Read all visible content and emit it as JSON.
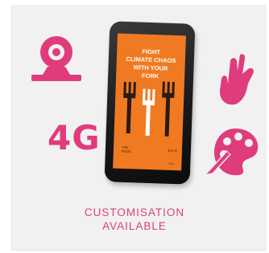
{
  "badge": {
    "network_label": "4G",
    "caption_line1": "CUSTOMISATION",
    "caption_line2": "AVAILABLE"
  },
  "tablet_screen": {
    "headline": "FIGHT\nCLIMATE CHAOS\nWITH YOUR\nFORK",
    "small_text": "THE ...\nFOOD ...",
    "small_text_right": "8  9   22",
    "footer_text": "hi-5 ..."
  },
  "icons": [
    "webcam-icon",
    "hand-touch-icon",
    "paint-palette-icon"
  ],
  "colors": {
    "accent": "#e03c7d",
    "screen_orange": "#f07a22",
    "card_background": "#f1f1f1"
  }
}
